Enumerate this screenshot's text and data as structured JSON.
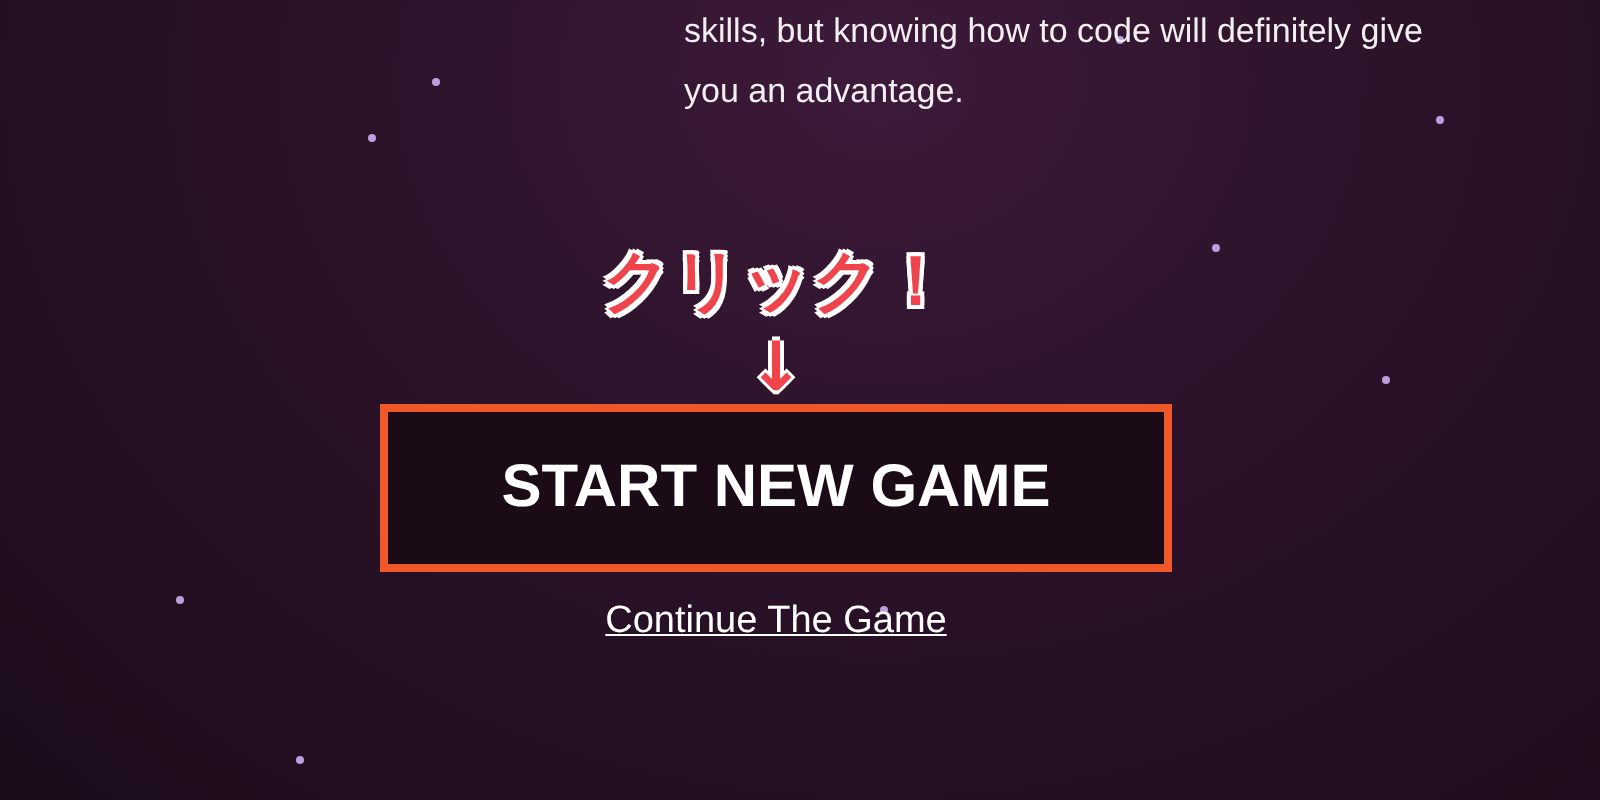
{
  "intro": {
    "lines": [
      "skills, but knowing how to code will definitely give",
      "you an advantage."
    ]
  },
  "annotation": {
    "callout": "クリック！",
    "arrow": "↓"
  },
  "start_button": {
    "label": "START NEW GAME"
  },
  "continue_link": {
    "label": "Continue The Game"
  }
}
